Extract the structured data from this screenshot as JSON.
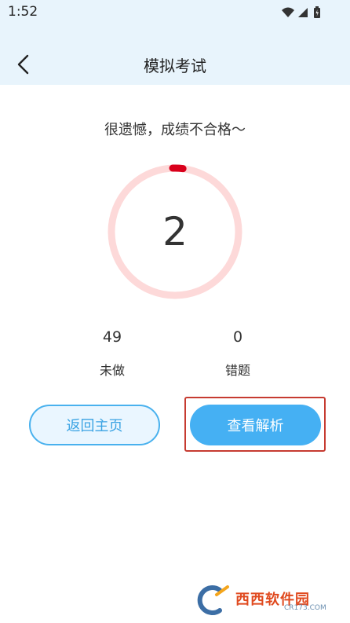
{
  "status_bar": {
    "time": "1:52",
    "icons": [
      "wifi-icon",
      "cellular-signal-icon",
      "battery-icon"
    ]
  },
  "header": {
    "back_icon": "chevron-left-icon",
    "title": "模拟考试"
  },
  "result": {
    "message": "很遗憾，成绩不合格～",
    "score": "2",
    "progress_fraction": 0.02
  },
  "stats": {
    "undone": {
      "value": "49",
      "label": "未做"
    },
    "wrong": {
      "value": "0",
      "label": "错题"
    }
  },
  "buttons": {
    "home_label": "返回主页",
    "analysis_label": "查看解析"
  },
  "watermark": {
    "name": "西西软件园",
    "url": "CR173.COM"
  },
  "colors": {
    "header_bg": "#e8f4fc",
    "ring_track": "#fdd9d9",
    "ring_progress": "#d9001b",
    "accent_blue": "#45b0f3",
    "highlight_red": "#c63b31"
  }
}
